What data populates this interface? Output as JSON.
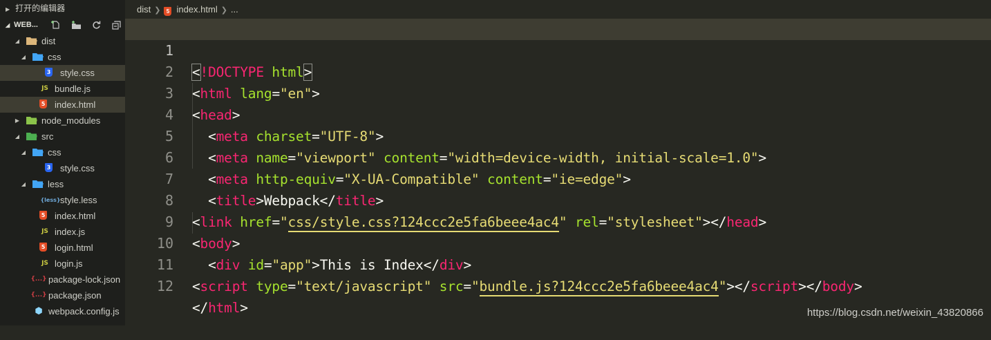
{
  "sidebar": {
    "open_editors_label": "打开的编辑器",
    "project_label": "WEB...",
    "tree": [
      {
        "label": "dist",
        "type": "folder-open",
        "depth": 1
      },
      {
        "label": "css",
        "type": "folder-open-css",
        "depth": 2
      },
      {
        "label": "style.css",
        "type": "css",
        "depth": 3,
        "selected": true
      },
      {
        "label": "bundle.js",
        "type": "js",
        "depth": 2
      },
      {
        "label": "index.html",
        "type": "html",
        "depth": 2,
        "selected": true
      },
      {
        "label": "node_modules",
        "type": "folder-node",
        "depth": 1
      },
      {
        "label": "src",
        "type": "folder-src",
        "depth": 1
      },
      {
        "label": "css",
        "type": "folder-open-css",
        "depth": 2
      },
      {
        "label": "style.css",
        "type": "css",
        "depth": 3
      },
      {
        "label": "less",
        "type": "folder-open-less",
        "depth": 2
      },
      {
        "label": "style.less",
        "type": "less",
        "depth": 3
      },
      {
        "label": "index.html",
        "type": "html",
        "depth": 2
      },
      {
        "label": "index.js",
        "type": "js",
        "depth": 2
      },
      {
        "label": "login.html",
        "type": "html",
        "depth": 2
      },
      {
        "label": "login.js",
        "type": "js",
        "depth": 2
      },
      {
        "label": "package-lock.json",
        "type": "json",
        "depth": 1
      },
      {
        "label": "package.json",
        "type": "json",
        "depth": 1
      },
      {
        "label": "webpack.config.js",
        "type": "webpack",
        "depth": 1
      }
    ]
  },
  "breadcrumb": {
    "folder": "dist",
    "file": "index.html",
    "more": "..."
  },
  "editor": {
    "current_line": 1,
    "lines": [
      {
        "n": "1"
      },
      {
        "n": "2"
      },
      {
        "n": "3"
      },
      {
        "n": "4"
      },
      {
        "n": "5"
      },
      {
        "n": "6"
      },
      {
        "n": "7"
      },
      {
        "n": "8"
      },
      {
        "n": "9"
      },
      {
        "n": "10"
      },
      {
        "n": "11"
      },
      {
        "n": "12"
      }
    ]
  },
  "code": {
    "l1": {
      "open": "<",
      "bang": "!",
      "doctype": "DOCTYPE",
      "html": "html",
      "close": ">"
    },
    "l2": {
      "tag": "html",
      "attr": "lang",
      "val": "\"en\""
    },
    "l3": {
      "tag": "head"
    },
    "l4": {
      "tag": "meta",
      "attr": "charset",
      "val": "\"UTF-8\""
    },
    "l5": {
      "tag": "meta",
      "attr1": "name",
      "val1": "\"viewport\"",
      "attr2": "content",
      "val2": "\"width=device-width, initial-scale=1.0\""
    },
    "l6": {
      "tag": "meta",
      "attr1": "http-equiv",
      "val1": "\"X-UA-Compatible\"",
      "attr2": "content",
      "val2": "\"ie=edge\""
    },
    "l7": {
      "tag": "title",
      "text": "Webpack"
    },
    "l8": {
      "tag": "link",
      "attr1": "href",
      "q": "\"",
      "path": "css/style.css?124ccc2e5fa6beee4ac4",
      "attr2": "rel",
      "val2": "\"stylesheet\"",
      "endtag": "head"
    },
    "l9": {
      "tag": "body"
    },
    "l10": {
      "tag": "div",
      "attr": "id",
      "val": "\"app\"",
      "text": "This is Index"
    },
    "l11": {
      "tag": "script",
      "attr1": "type",
      "val1": "\"text/javascript\"",
      "attr2": "src",
      "q": "\"",
      "path": "bundle.js?124ccc2e5fa6beee4ac4",
      "endbody": "body"
    },
    "l12": {
      "tag": "html"
    }
  },
  "watermark": "https://blog.csdn.net/weixin_43820866",
  "colors": {
    "tag": "#f92672",
    "attr": "#a6e22e",
    "string": "#e6db74",
    "bg": "#272822",
    "sidebar_bg": "#1e1f1c"
  }
}
